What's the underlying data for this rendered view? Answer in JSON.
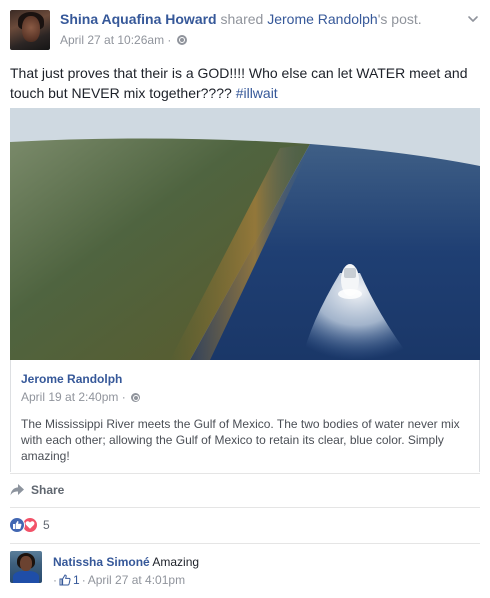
{
  "post": {
    "author_name": "Shina Aquafina Howard",
    "shared_text": " shared ",
    "shared_author_link": "Jerome Randolph",
    "shared_suffix": "'s post.",
    "timestamp": "April 27 at 10:26am",
    "separator": " · ",
    "privacy_icon": "globe-icon",
    "text_main": "That just proves that their is a GOD!!!! Who else can let WATER meet and touch but NEVER mix together???? ",
    "hashtag": "#illwait"
  },
  "shared_post": {
    "author": "Jerome Randolph",
    "timestamp": "April 19 at 2:40pm",
    "separator": " · ",
    "caption": "The Mississippi River meets the Gulf of Mexico. The two bodies of water never mix with each other; allowing the Gulf of Mexico to retain its clear, blue color. Simply amazing!",
    "image_subject": "aerial-ocean-boat-photo"
  },
  "actions": {
    "share_label": "Share",
    "share_icon": "share-arrow-icon"
  },
  "reactions": {
    "count": "5",
    "icons": [
      "like-icon",
      "love-icon"
    ]
  },
  "comments": [
    {
      "name": "Natissha Simoné",
      "text": "Amazing",
      "like_count": "1",
      "meta_prefix": "·",
      "separator": " · ",
      "timestamp": "April 27 at 4:01pm"
    }
  ],
  "colors": {
    "link": "#365899",
    "muted": "#90949c",
    "like_blue": "#4267b2",
    "love_red": "#f25268"
  }
}
